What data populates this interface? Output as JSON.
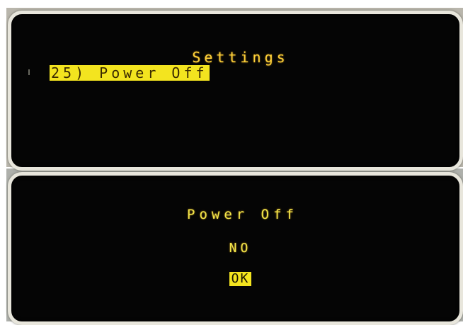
{
  "settings_screen": {
    "title": "Settings",
    "selected_item": "25) Power Off"
  },
  "power_off_screen": {
    "title": "Power Off",
    "option_no": "NO",
    "option_ok": "OK",
    "selected_option": "OK"
  },
  "colors": {
    "lcd_text": "#ffd23a",
    "highlight": "#f3e41f",
    "screen_background": "#050505",
    "bezel": "#e8e6dc"
  }
}
